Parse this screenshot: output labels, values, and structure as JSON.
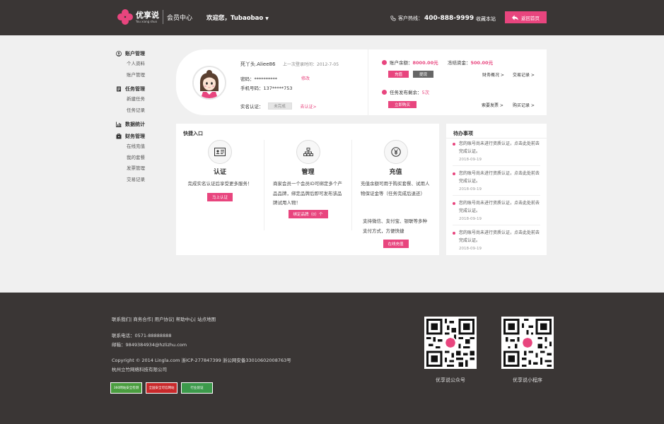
{
  "header": {
    "logo_cn": "优享说",
    "logo_en": "You xiang shuo",
    "section": "会员中心",
    "welcome": "欢迎您，Tubaobao",
    "hotline_label": "客户热线：",
    "hotline": "400-888-9999",
    "favorite": "收藏本站",
    "back_home": "返回首页"
  },
  "sidebar": {
    "groups": [
      {
        "title": "账户管理",
        "icon": "user-icon",
        "items": [
          "个人资料",
          "账户管理"
        ]
      },
      {
        "title": "任务管理",
        "icon": "task-icon",
        "items": [
          "新建任务",
          "任务记录"
        ]
      },
      {
        "title": "数据统计",
        "icon": "chart-icon",
        "items": []
      },
      {
        "title": "财务管理",
        "icon": "finance-icon",
        "items": [
          "在线充值",
          "我的套餐",
          "发票管理",
          "交易记录"
        ]
      }
    ]
  },
  "profile": {
    "name": "死丫头.Aliee86",
    "last_login": "上一次登录时间：2012-7-05",
    "password": "密码：**********",
    "edit": "修改",
    "phone": "手机号码：137*****753",
    "verify_label": "实名认证：",
    "verify_status": "未完成",
    "go_verify": "去认证>",
    "balance_label": "账户余额：",
    "balance": "8000.00元",
    "frozen_label": "冻结资金：",
    "frozen": "500.00元",
    "charge": "充值",
    "withdraw": "提现",
    "fund_overview": "财务概况 >",
    "trade_records": "交易记录 >",
    "tasks_label": "任务发布剩余：",
    "tasks": "5次",
    "buy_now": "立即购买",
    "invoice": "索要发票 >",
    "buy_records": "购买记录 >"
  },
  "quick": {
    "title": "快捷入口",
    "cols": [
      {
        "name": "认证",
        "icon": "id-card-icon",
        "desc": "完成实名认证后享受更多服务！",
        "desc2": "",
        "button": "马上认证"
      },
      {
        "name": "管理",
        "icon": "hierarchy-icon",
        "desc": "商家会员一个会员ID可绑定多个产品品牌，绑定品牌后即可发布该品牌试用人物！",
        "desc2": "",
        "button": "绑定品牌（0）个"
      },
      {
        "name": "充值",
        "icon": "money-icon",
        "desc": "充值余额可用于购买套餐、试用人物保证金等（任务完成后退还）",
        "desc2": "支持微信、支付宝、银联等多种支付方式，方便快捷",
        "button": "在线充值"
      }
    ]
  },
  "todo": {
    "title": "待办事项",
    "items": [
      {
        "text": "您的账号尚未进行资质认证，点击此处前去完成认证。",
        "date": "2018-09-19"
      },
      {
        "text": "您的账号尚未进行资质认证，点击此处前去完成认证。",
        "date": "2018-09-19"
      },
      {
        "text": "您的账号尚未进行资质认证，点击此处前去完成认证。",
        "date": "2018-09-19"
      },
      {
        "text": "您的账号尚未进行资质认证，点击此处前去完成认证。",
        "date": "2018-09-19"
      }
    ]
  },
  "footer": {
    "links": [
      "联系我们",
      "商务合作",
      "用户协议",
      "帮助中心",
      "站点地图"
    ],
    "tel": "联系电话：0571-88888888",
    "mail": "邮箱：9849384934@hzlizhu.com",
    "copyright": "Copyright © 2014 Lingla.com 浙ICP-277847399  浙公网安备33010602008763号",
    "company": "杭州立竹网络科技有限公司",
    "badges": [
      {
        "text": "360网站安全检测",
        "color": "#4a9d3f"
      },
      {
        "text": "全国安全可信网站",
        "color": "#c8292b"
      },
      {
        "text": "行业验证",
        "color": "#3c9a4b"
      }
    ],
    "qr_labels": [
      "优享说公众号",
      "优享说小程序"
    ]
  }
}
